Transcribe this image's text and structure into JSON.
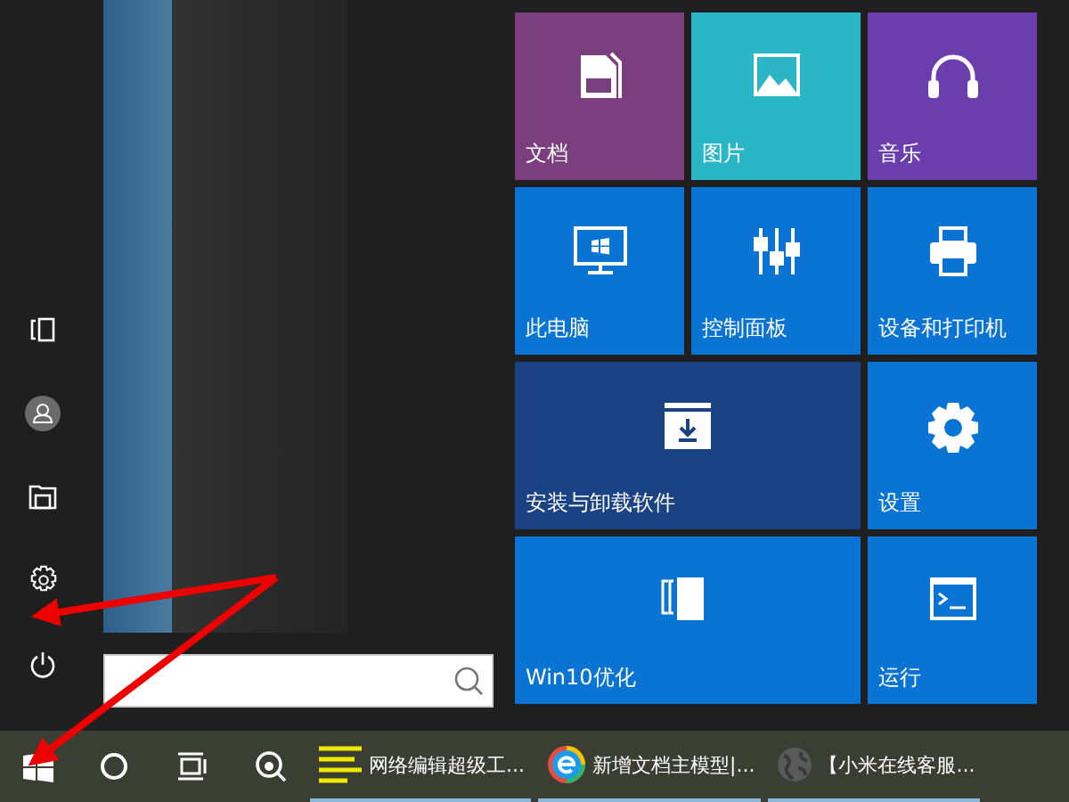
{
  "sidebar": {
    "items": [
      {
        "kind": "tablet"
      },
      {
        "kind": "user"
      },
      {
        "kind": "explorer"
      },
      {
        "kind": "settings"
      },
      {
        "kind": "power"
      }
    ]
  },
  "tiles": [
    {
      "label": "文档",
      "kind": "document",
      "color": "#7b3f80",
      "wide": false
    },
    {
      "label": "图片",
      "kind": "picture",
      "color": "#2bb6c6",
      "wide": false
    },
    {
      "label": "音乐",
      "kind": "music",
      "color": "#6a3eac",
      "wide": false
    },
    {
      "label": "此电脑",
      "kind": "computer",
      "color": "#0a74d4",
      "wide": false
    },
    {
      "label": "控制面板",
      "kind": "sliders",
      "color": "#0a74d4",
      "wide": false
    },
    {
      "label": "设备和打印机",
      "kind": "printer",
      "color": "#0a74d4",
      "wide": false
    },
    {
      "label": "安装与卸载软件",
      "kind": "archive",
      "color": "#1b4282",
      "wide": true
    },
    {
      "label": "设置",
      "kind": "gear",
      "color": "#0a74d4",
      "wide": false
    },
    {
      "label": "Win10优化",
      "kind": "bracket",
      "color": "#0a74d4",
      "wide": true
    },
    {
      "label": "运行",
      "kind": "terminal",
      "color": "#0a74d4",
      "wide": false
    }
  ],
  "taskbar": {
    "icons": [
      {
        "kind": "start"
      },
      {
        "kind": "cortana"
      },
      {
        "kind": "taskview"
      },
      {
        "kind": "magnifier"
      }
    ],
    "apps": [
      {
        "label": "网络编辑超级工...",
        "kind": "lines"
      },
      {
        "label": "新增文档主模型|...",
        "kind": "browser"
      },
      {
        "label": "【小米在线客服...",
        "kind": "globe"
      }
    ]
  }
}
